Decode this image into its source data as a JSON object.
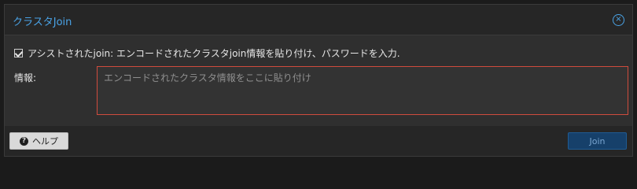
{
  "dialog": {
    "title": "クラスタJoin",
    "close_icon": "close-icon",
    "assisted_join_checkbox": {
      "checked": true,
      "label": "アシストされたjoin: エンコードされたクラスタjoin情報を貼り付け、パスワードを入力."
    },
    "info_field": {
      "label": "情報:",
      "placeholder": "エンコードされたクラスタ情報をここに貼り付け",
      "value": ""
    },
    "buttons": {
      "help": {
        "label": "ヘルプ",
        "icon": "question-circle-icon"
      },
      "join": {
        "label": "Join"
      }
    }
  }
}
